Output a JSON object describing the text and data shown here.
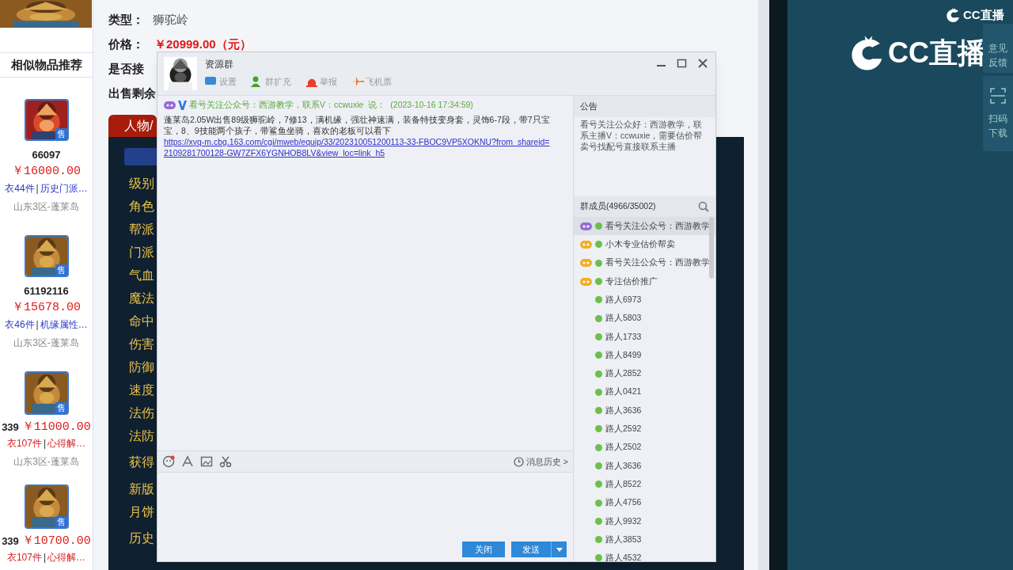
{
  "similar": {
    "title": "相似物品推荐",
    "items": [
      {
        "id": "66097",
        "price": "￥16000.00",
        "badge": "售",
        "links": [
          "衣44件",
          "历史门派…"
        ],
        "separator": "|",
        "hot": false,
        "server": "山东3区-蓬莱岛"
      },
      {
        "id": "61192116",
        "price": "￥15678.00",
        "badge": "售",
        "links": [
          "衣46件",
          "机缘属性…"
        ],
        "separator": "|",
        "hot": false,
        "server": "山东3区-蓬莱岛"
      },
      {
        "id": "339",
        "price": "￥11000.00",
        "badge": "售",
        "links": [
          "衣107件",
          "心得解…"
        ],
        "separator": "|",
        "hot": true,
        "server": "山东3区-蓬莱岛"
      },
      {
        "id": "339",
        "price": "￥10700.00",
        "badge": "售",
        "links": [
          "衣107件",
          "心得解…"
        ],
        "separator": "|",
        "hot": true
      }
    ]
  },
  "detail": {
    "fields": [
      {
        "label": "类型：",
        "value": "狮驼岭",
        "kind": "plain"
      },
      {
        "label": "价格：",
        "value": "￥20999.00（元）",
        "kind": "price"
      },
      {
        "label": "是否接"
      },
      {
        "label": "出售剩余"
      }
    ],
    "tab": "人物/",
    "attributes": [
      "级别",
      "角色",
      "帮派",
      "门派",
      "气血",
      "魔法",
      "命中",
      "伤害",
      "防御",
      "速度",
      "法伤",
      "法防",
      "获得",
      "新版",
      "月饼",
      "历史"
    ]
  },
  "chat": {
    "title": "资源群",
    "toolbar": [
      "设置",
      "群扩充",
      "举报",
      "飞机票"
    ],
    "message": {
      "sender": "看号关注公众号：西游教学，联系V：ccwuxie",
      "said": "说：",
      "time": "(2023-10-16 17:34:59)",
      "text": "蓬莱岛2.05W出售89级狮驼岭，7修13，满机缘，强壮神速满，装备特技变身套，灵饰6-7段，带7只宝宝，8、9技能两个孩子，带鲨鱼坐骑，喜欢的老板可以看下",
      "link": "https://xyq-m.cbg.163.com/cgi/mweb/equip/33/202310051200113-33-FBOC9VP5XOKNU?from_shareid=2109281700128-GW7ZFX6YGNHOB8LV&view_loc=link_h5"
    },
    "history": "消息历史 >",
    "close": "关闭",
    "send": "发送",
    "notice": {
      "title": "公告",
      "text": "看号关注公众好：西游教学，联系主播V：ccwuxie，需要估价帮卖号找配号直接联系主播"
    },
    "members_title": "群成员(4966/35002)",
    "members": [
      {
        "name": "看号关注公众号：西游教学",
        "kind": "owner",
        "selected": true
      },
      {
        "name": "小木专业估价帮卖",
        "kind": "admin",
        "selected": false
      },
      {
        "name": "看号关注公众号：西游教学",
        "kind": "admin",
        "selected": false
      },
      {
        "name": "专注估价推广",
        "kind": "admin",
        "selected": false
      },
      {
        "name": "路人6973",
        "kind": "member",
        "selected": false
      },
      {
        "name": "路人5803",
        "kind": "member",
        "selected": false
      },
      {
        "name": "路人1733",
        "kind": "member",
        "selected": false
      },
      {
        "name": "路人8499",
        "kind": "member",
        "selected": false
      },
      {
        "name": "路人2852",
        "kind": "member",
        "selected": false
      },
      {
        "name": "路人0421",
        "kind": "member",
        "selected": false
      },
      {
        "name": "路人3636",
        "kind": "member",
        "selected": false
      },
      {
        "name": "路人2592",
        "kind": "member",
        "selected": false
      },
      {
        "name": "路人2502",
        "kind": "member",
        "selected": false
      },
      {
        "name": "路人3636",
        "kind": "member",
        "selected": false
      },
      {
        "name": "路人8522",
        "kind": "member",
        "selected": false
      },
      {
        "name": "路人4756",
        "kind": "member",
        "selected": false
      },
      {
        "name": "路人9932",
        "kind": "member",
        "selected": false
      },
      {
        "name": "路人3853",
        "kind": "member",
        "selected": false
      },
      {
        "name": "路人4532",
        "kind": "member",
        "selected": false
      }
    ]
  },
  "stream": {
    "logo": "CC直播",
    "corner_logo": "CC直播",
    "side": [
      "意见反馈",
      "扫码下载"
    ]
  }
}
